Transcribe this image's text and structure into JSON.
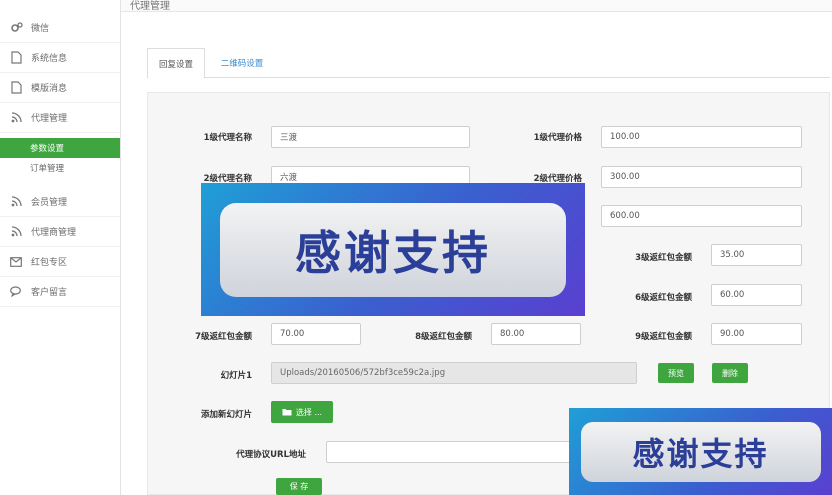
{
  "page": {
    "title": "代理管理"
  },
  "sidebar": {
    "items": [
      {
        "label": "微信",
        "icon": "gears-icon"
      },
      {
        "label": "系统信息",
        "icon": "file-icon"
      },
      {
        "label": "模版消息",
        "icon": "file-icon"
      },
      {
        "label": "代理管理",
        "icon": "rss-icon"
      },
      {
        "label": "会员管理",
        "icon": "rss-icon"
      },
      {
        "label": "代理商管理",
        "icon": "rss-icon"
      },
      {
        "label": "红包专区",
        "icon": "mail-icon"
      },
      {
        "label": "客户留言",
        "icon": "chat-icon"
      }
    ],
    "sub_items": [
      {
        "label": "参数设置",
        "active": true
      },
      {
        "label": "订单管理",
        "active": false
      }
    ]
  },
  "tabs": [
    {
      "label": "回复设置",
      "active": true
    },
    {
      "label": "二维码设置",
      "active": false
    }
  ],
  "form": {
    "agent1_name_label": "1级代理名称",
    "agent1_name_value": "三渡",
    "agent1_price_label": "1级代理价格",
    "agent1_price_value": "100.00",
    "agent2_name_label": "2级代理名称",
    "agent2_name_value": "六渡",
    "agent2_price_label": "2级代理价格",
    "agent2_price_value": "300.00",
    "agent3_price_value": "600.00",
    "rp3_label": "3级返红包金额",
    "rp3_value": "35.00",
    "rp6_label": "6级返红包金额",
    "rp6_value": "60.00",
    "rp7_label": "7级返红包金额",
    "rp7_value": "70.00",
    "rp8_label": "8级返红包金额",
    "rp8_value": "80.00",
    "rp9_label": "9级返红包金额",
    "rp9_value": "90.00",
    "slide_label": "幻灯片1",
    "slide_value": "Uploads/20160506/572bf3ce59c2a.jpg",
    "preview_label": "预览",
    "delete_label": "删除",
    "add_slide_label": "添加新幻灯片",
    "select_label": "选择 ...",
    "url_label": "代理协议URL地址",
    "url_value": "",
    "save_label": "保 存"
  },
  "overlays": {
    "big_text": "感谢支持",
    "small_text": "感谢支持"
  },
  "colors": {
    "accent_green": "#3fa63f",
    "overlay_blue": "#3a5fcf",
    "overlay_text": "#2b3f99"
  }
}
